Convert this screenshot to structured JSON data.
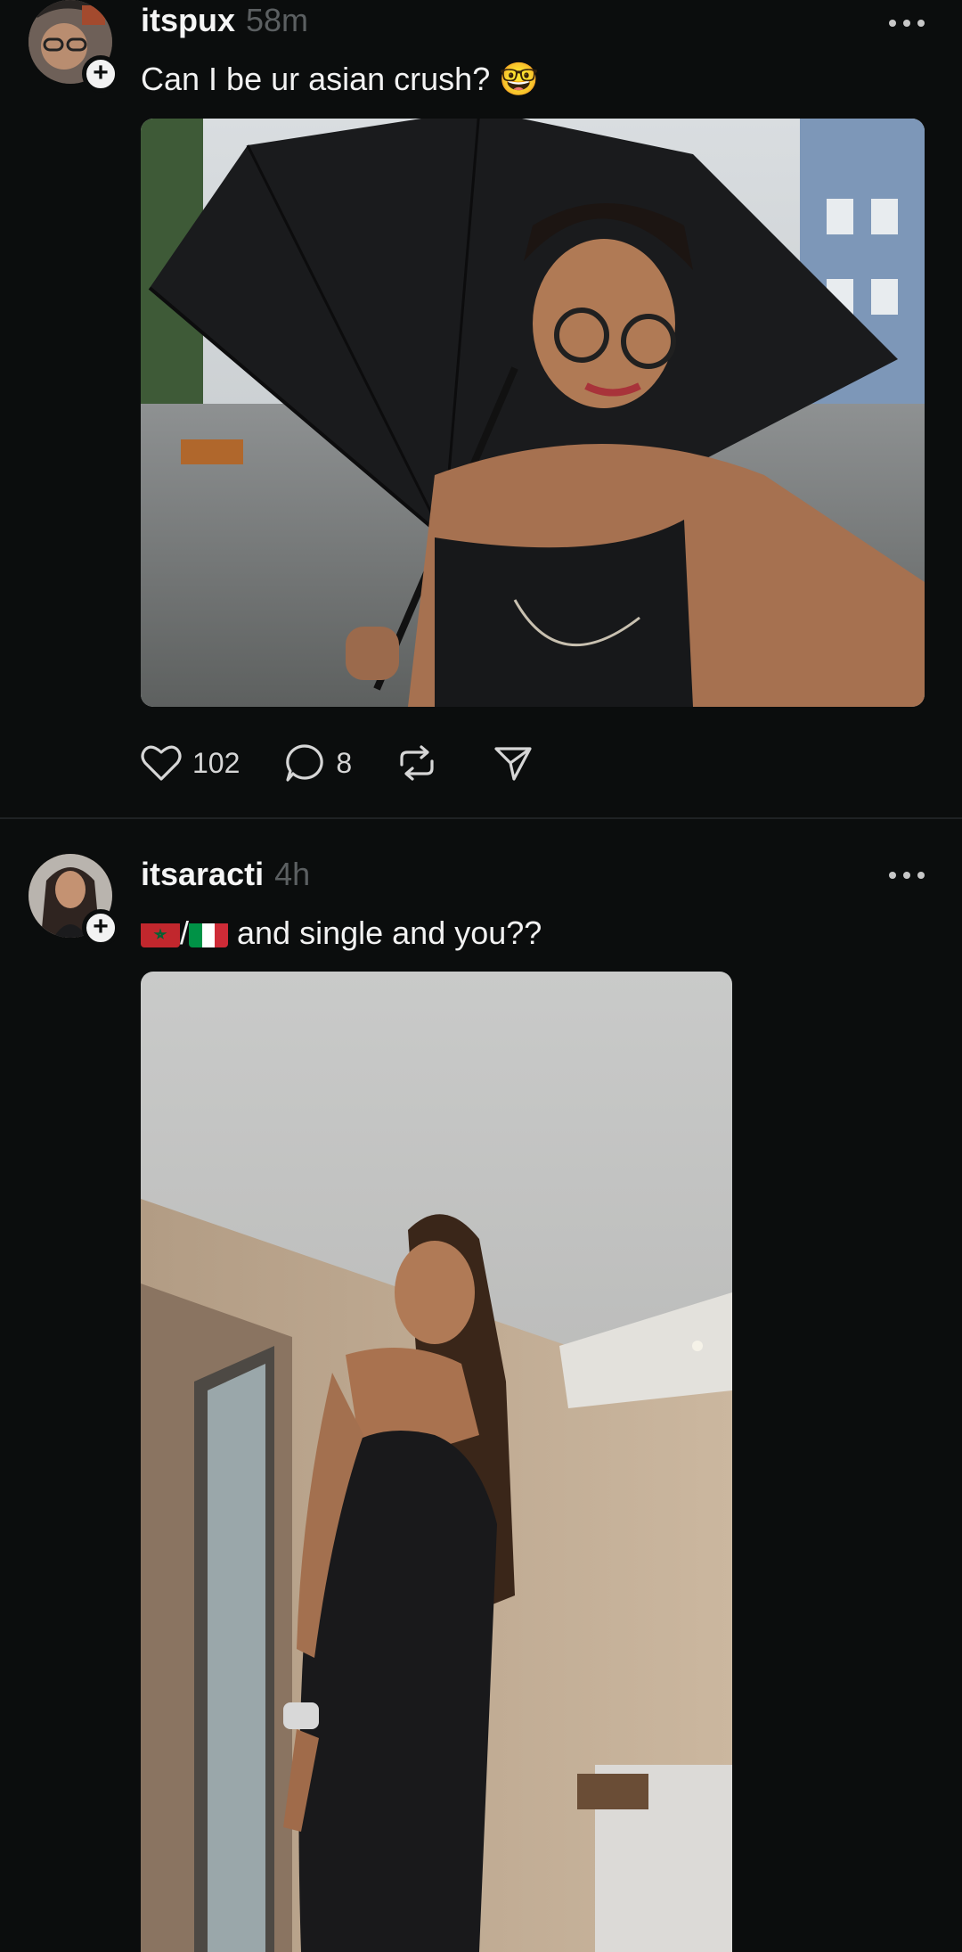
{
  "posts": [
    {
      "username": "itspux",
      "time": "58m",
      "caption": "Can I be ur asian crush? 🤓",
      "likes": "102",
      "comments": "8"
    },
    {
      "username": "itsaracti",
      "time": "4h",
      "caption_separator": "/",
      "caption_text": " and single and you??",
      "flags": [
        "morocco-flag",
        "italy-flag"
      ]
    }
  ],
  "icons": {
    "follow": "+",
    "like": "heart-icon",
    "comment": "comment-icon",
    "repost": "repost-icon",
    "share": "share-icon",
    "more": "more-icon"
  },
  "colors": {
    "background": "#0b0d0d",
    "text": "#f2f2f2",
    "muted": "#5b5f61"
  }
}
